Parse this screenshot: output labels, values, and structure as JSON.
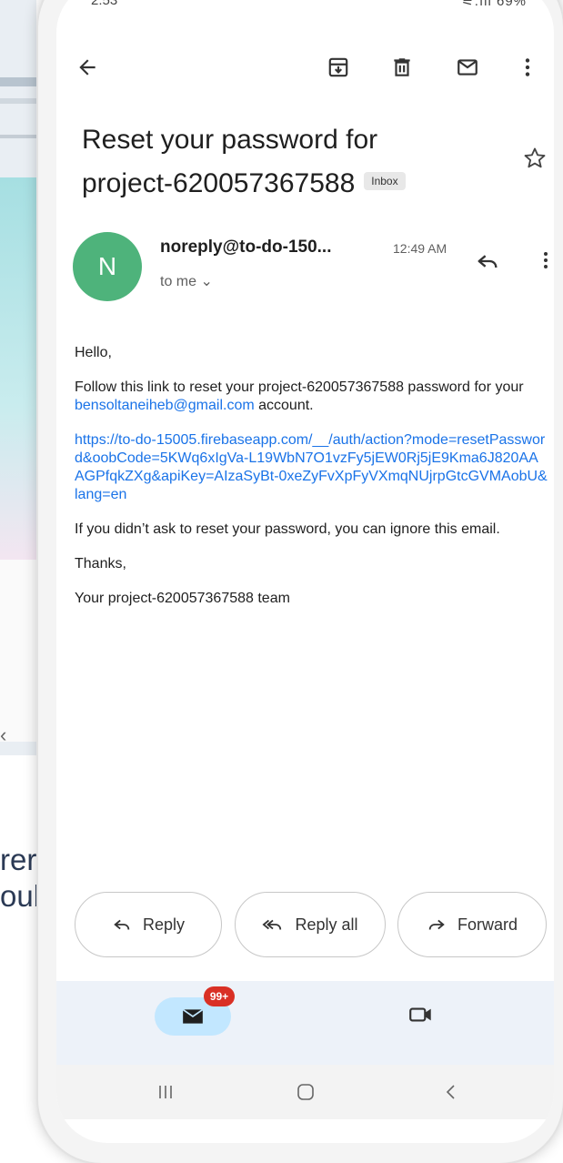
{
  "background": {
    "caption_line1": "rer son mot",
    "caption_line2": "oubli."
  },
  "status_bar": {
    "time": "2:53",
    "icons": "⚟.ıll 69%"
  },
  "toolbar": {
    "back_icon": "arrow-left-icon",
    "archive_icon": "archive-icon",
    "delete_icon": "trash-icon",
    "mark_unread_icon": "mail-icon",
    "more_icon": "more-vert-icon"
  },
  "email": {
    "subject_line1": "Reset your password for",
    "subject_line2": "project-620057367588",
    "label": "Inbox",
    "sender_initial": "N",
    "sender": "noreply@to-do-150...",
    "time": "12:49 AM",
    "recipient": "to me ⌄",
    "greeting": "Hello,",
    "para1_a": "Follow this link to reset your project-620057367588 password for your ",
    "para1_email": "bensoltaneiheb@gmail.com",
    "para1_b": " account.",
    "url": "https://to-do-15005.firebaseapp.com/__/auth/action?mode=resetPassword&oobCode=5KWq6xIgVa-L19WbN7O1vzFy5jEW0Rj5jE9Kma6J820AAAGPfqkZXg&apiKey=AIzaSyBt-0xeZyFvXpFyVXmqNUjrpGtcGVMAobU&lang=en",
    "para2": "If you didn’t ask to reset your password, you can ignore this email.",
    "thanks": "Thanks,",
    "signature": "Your project-620057367588 team"
  },
  "actions": {
    "reply": "Reply",
    "reply_all": "Reply all",
    "forward": "Forward"
  },
  "bottom_nav": {
    "mail_badge": "99+"
  },
  "colors": {
    "avatar": "#4eb37b",
    "link": "#1a73e8",
    "badge": "#d93025",
    "nav_pill": "#c2e7ff"
  }
}
